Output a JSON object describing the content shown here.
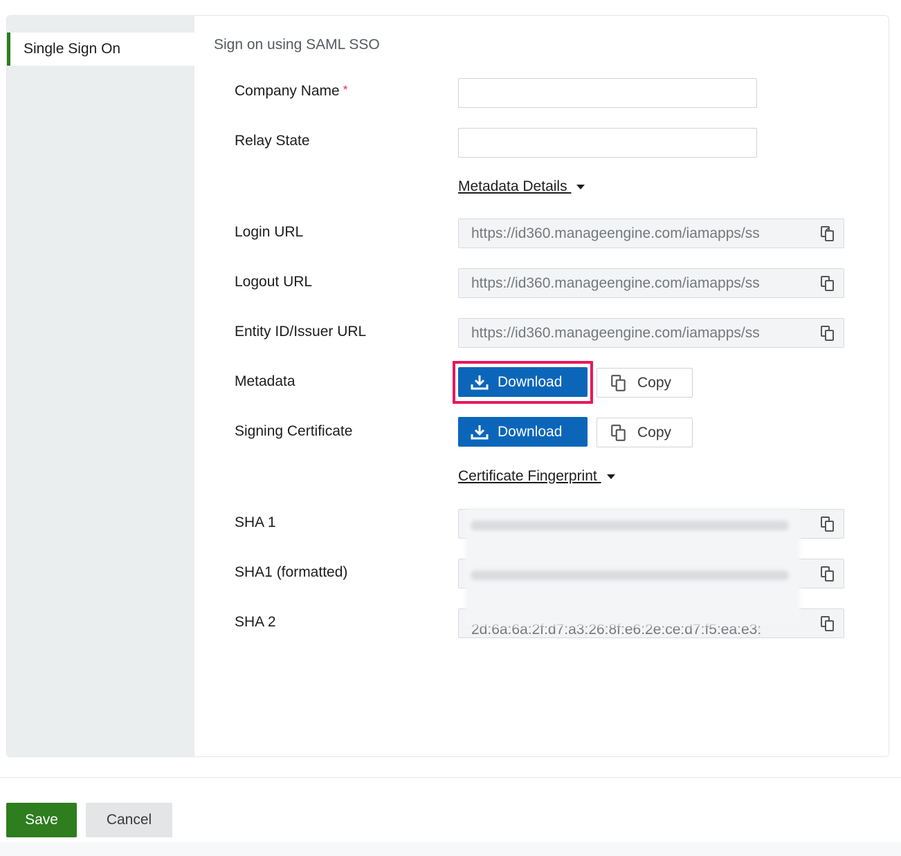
{
  "sidebar": {
    "items": [
      {
        "label": "Single Sign On",
        "active": true
      }
    ]
  },
  "main": {
    "section_title": "Sign on using SAML SSO",
    "fields": {
      "company_name": {
        "label": "Company Name",
        "required_mark": "*",
        "value": ""
      },
      "relay_state": {
        "label": "Relay State",
        "value": ""
      }
    },
    "metadata_details": {
      "toggle_label": "Metadata Details ",
      "login_url": {
        "label": "Login URL",
        "value": "https://id360.manageengine.com/iamapps/ss"
      },
      "logout_url": {
        "label": "Logout URL",
        "value": "https://id360.manageengine.com/iamapps/ss"
      },
      "entity_id": {
        "label": "Entity ID/Issuer URL",
        "value": "https://id360.manageengine.com/iamapps/ss"
      },
      "metadata": {
        "label": "Metadata",
        "download_label": "Download",
        "copy_label": "Copy",
        "highlighted": true
      },
      "signing_certificate": {
        "label": "Signing Certificate",
        "download_label": "Download",
        "copy_label": "Copy"
      }
    },
    "certificate_fingerprint": {
      "toggle_label": "Certificate Fingerprint ",
      "sha1": {
        "label": "SHA 1",
        "value": ""
      },
      "sha1_formatted": {
        "label": "SHA1 (formatted)",
        "value": ""
      },
      "sha2": {
        "label": "SHA 2",
        "value": "2d:6a:6a:2f:d7:a3:26:8f:e6:2e:ce:d7:f5:ea:e3:"
      }
    }
  },
  "footer": {
    "save_label": "Save",
    "cancel_label": "Cancel"
  },
  "colors": {
    "primary_blue": "#0b66b9",
    "save_green": "#2e7d1f",
    "highlight_pink": "#e8175d",
    "sidebar_bg": "#ebeeef"
  },
  "icons": {
    "copy": "copy-icon",
    "download": "download-icon",
    "caret": "caret-down-icon"
  }
}
